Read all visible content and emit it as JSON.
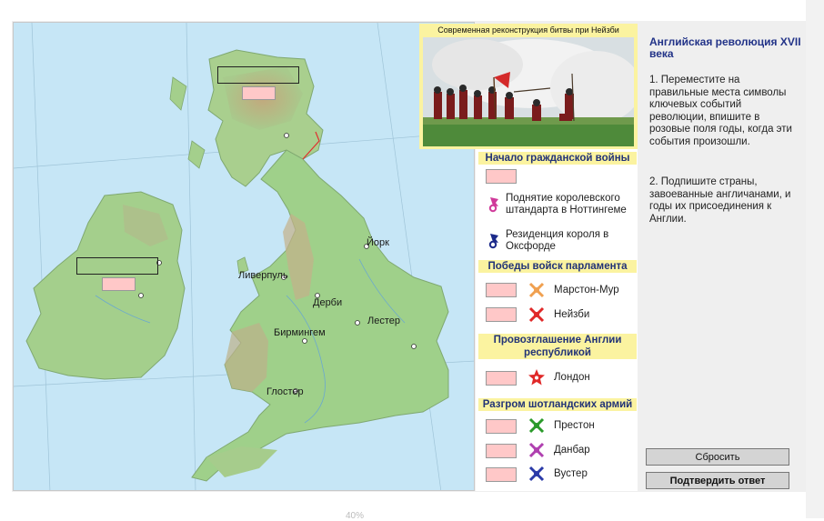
{
  "photo": {
    "caption": "Современная реконструкция битвы при Нейзби"
  },
  "map": {
    "cities": {
      "york": "Йорк",
      "liverpool": "Ливерпуль",
      "derby": "Дерби",
      "leicester": "Лестер",
      "birmingham": "Бирмингем",
      "gloucester": "Глостер"
    }
  },
  "legend": {
    "civil_war_start": "Начало гражданской войны",
    "raising_standard": "Поднятие королевского штандарта в Ноттингеме",
    "king_residence": "Резиденция короля в Оксфорде",
    "parliament_victories": "Победы войск парламента",
    "marston_moor": "Марстон-Мур",
    "naseby": "Нейзби",
    "republic": "Провозглашение Англии республикой",
    "london": "Лондон",
    "scots_defeat": "Разгром шотландских армий",
    "preston": "Престон",
    "dunbar": "Данбар",
    "worcester": "Вустер"
  },
  "side": {
    "title": "Английская революция XVII века",
    "task1": "1. Переместите на правильные места символы ключевых событий революции, впишите в розовые поля годы, когда эти события произошли.",
    "task2": "2. Подпишите страны, завоеванные англичанами, и годы их присоединения к Англии."
  },
  "buttons": {
    "reset": "Сбросить",
    "confirm": "Подтвердить ответ"
  },
  "footer_fragment": "40%",
  "colors": {
    "sea": "#c6e6f6",
    "land": "#9fd08a",
    "highlands": "#c9a47a",
    "legend_header_bg": "#fbf3a0",
    "legend_header_text": "#223377",
    "year_box": "#ffc8c8",
    "icon_magenta": "#d03a9a",
    "icon_navy": "#1b2a8a",
    "icon_orange": "#f0a050",
    "icon_red": "#e02828",
    "icon_green": "#2a9a2a",
    "icon_purple": "#b040b0",
    "icon_blue": "#2a3aa8"
  }
}
